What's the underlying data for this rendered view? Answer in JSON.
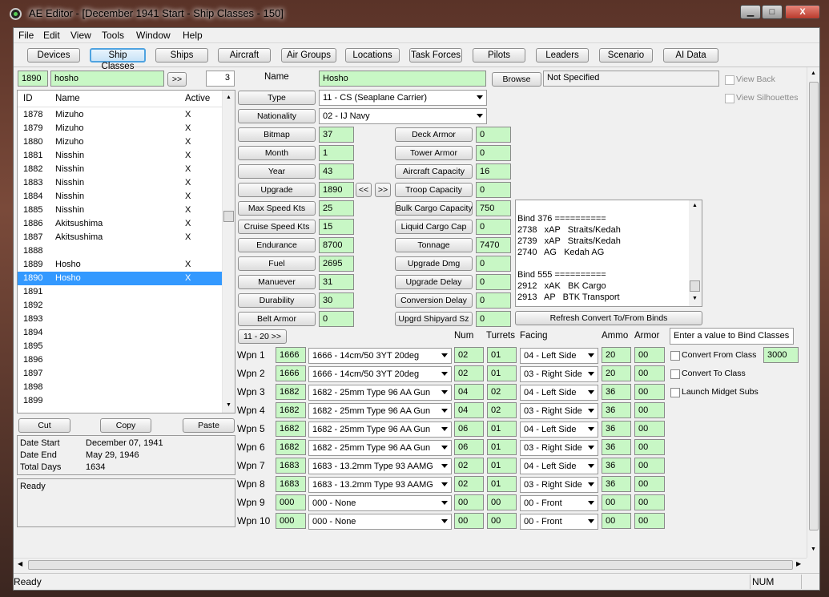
{
  "window": {
    "title": "AE Editor - [December 1941 Start - Ship Classes - 150]",
    "min": "▁",
    "max": "□",
    "close": "X"
  },
  "menu": [
    "File",
    "Edit",
    "View",
    "Tools",
    "Window",
    "Help"
  ],
  "tabs": [
    "Devices",
    "Ship Classes",
    "Ships",
    "Aircraft",
    "Air Groups",
    "Locations",
    "Task Forces",
    "Pilots",
    "Leaders",
    "Scenario",
    "AI Data"
  ],
  "search": {
    "id": "1890",
    "name": "hosho",
    "go": ">>",
    "count": "3"
  },
  "list": {
    "headers": [
      "ID",
      "Name",
      "Active"
    ],
    "rows": [
      [
        "1878",
        "Mizuho",
        "X"
      ],
      [
        "1879",
        "Mizuho",
        "X"
      ],
      [
        "1880",
        "Mizuho",
        "X"
      ],
      [
        "1881",
        "Nisshin",
        "X"
      ],
      [
        "1882",
        "Nisshin",
        "X"
      ],
      [
        "1883",
        "Nisshin",
        "X"
      ],
      [
        "1884",
        "Nisshin",
        "X"
      ],
      [
        "1885",
        "Nisshin",
        "X"
      ],
      [
        "1886",
        "Akitsushima",
        "X"
      ],
      [
        "1887",
        "Akitsushima",
        "X"
      ],
      [
        "1888",
        "",
        ""
      ],
      [
        "1889",
        "Hosho",
        "X"
      ],
      [
        "1890",
        "Hosho",
        "X"
      ],
      [
        "1891",
        "",
        ""
      ],
      [
        "1892",
        "",
        ""
      ],
      [
        "1893",
        "",
        ""
      ],
      [
        "1894",
        "",
        ""
      ],
      [
        "1895",
        "",
        ""
      ],
      [
        "1896",
        "",
        ""
      ],
      [
        "1897",
        "",
        ""
      ],
      [
        "1898",
        "",
        ""
      ],
      [
        "1899",
        "",
        ""
      ]
    ]
  },
  "actions": {
    "cut": "Cut",
    "copy": "Copy",
    "paste": "Paste"
  },
  "dates": {
    "start_label": "Date Start",
    "start": "December 07, 1941",
    "end_label": "Date End",
    "end": "May 29, 1946",
    "days_label": "Total Days",
    "days": "1634"
  },
  "log": "Ready",
  "name": {
    "label": "Name",
    "value": "Hosho",
    "browse": "Browse",
    "file": "Not Specified"
  },
  "view": {
    "back": "View Back",
    "silhouettes": "View Silhouettes"
  },
  "type": {
    "label": "Type",
    "value": "11 - CS (Seaplane Carrier)"
  },
  "nationality": {
    "label": "Nationality",
    "value": "02 - IJ Navy"
  },
  "left_fields": [
    [
      "Bitmap",
      "37"
    ],
    [
      "Month",
      "1"
    ],
    [
      "Year",
      "43"
    ],
    [
      "Upgrade",
      "1890"
    ],
    [
      "Max Speed Kts",
      "25"
    ],
    [
      "Cruise Speed Kts",
      "15"
    ],
    [
      "Endurance",
      "8700"
    ],
    [
      "Fuel",
      "2695"
    ],
    [
      "Manuever",
      "31"
    ],
    [
      "Durability",
      "30"
    ],
    [
      "Belt Armor",
      "0"
    ]
  ],
  "upgrade_nav": {
    "prev": "<<",
    "next": ">>"
  },
  "right_fields": [
    [
      "Deck Armor",
      "0"
    ],
    [
      "Tower Armor",
      "0"
    ],
    [
      "Aircraft Capacity",
      "16"
    ],
    [
      "Troop Capacity",
      "0"
    ],
    [
      "Bulk Cargo Capacity",
      "750"
    ],
    [
      "Liquid Cargo Cap",
      "0"
    ],
    [
      "Tonnage",
      "7470"
    ],
    [
      "Upgrade Dmg",
      "0"
    ],
    [
      "Upgrade Delay",
      "0"
    ],
    [
      "Conversion Delay",
      "0"
    ],
    [
      "Upgrd Shipyard Sz",
      "0"
    ]
  ],
  "binds": [
    "",
    "Bind 376 ==========",
    "2738   xAP   Straits/Kedah",
    "2739   xAP   Straits/Kedah",
    "2740   AG   Kedah AG",
    "",
    "Bind 555 ==========",
    "2912   xAK   BK Cargo",
    "2913   AP   BTK Transport"
  ],
  "refresh": "Refresh Convert To/From Binds",
  "weapons_nav": "11 - 20  >>",
  "weapon_headers": {
    "num": "Num",
    "turrets": "Turrets",
    "facing": "Facing",
    "ammo": "Ammo",
    "armor": "Armor"
  },
  "weapons": [
    [
      "Wpn 1",
      "1666",
      "1666 - 14cm/50 3YT 20deg",
      "02",
      "01",
      "04 - Left Side",
      "20",
      "00"
    ],
    [
      "Wpn 2",
      "1666",
      "1666 - 14cm/50 3YT 20deg",
      "02",
      "01",
      "03 - Right Side",
      "20",
      "00"
    ],
    [
      "Wpn 3",
      "1682",
      "1682 - 25mm Type 96 AA Gun",
      "04",
      "02",
      "04 - Left Side",
      "36",
      "00"
    ],
    [
      "Wpn 4",
      "1682",
      "1682 - 25mm Type 96 AA Gun",
      "04",
      "02",
      "03 - Right Side",
      "36",
      "00"
    ],
    [
      "Wpn 5",
      "1682",
      "1682 - 25mm Type 96 AA Gun",
      "06",
      "01",
      "04 - Left Side",
      "36",
      "00"
    ],
    [
      "Wpn 6",
      "1682",
      "1682 - 25mm Type 96 AA Gun",
      "06",
      "01",
      "03 - Right Side",
      "36",
      "00"
    ],
    [
      "Wpn 7",
      "1683",
      "1683 - 13.2mm Type 93 AAMG",
      "02",
      "01",
      "04 - Left Side",
      "36",
      "00"
    ],
    [
      "Wpn 8",
      "1683",
      "1683 - 13.2mm Type 93 AAMG",
      "02",
      "01",
      "03 - Right Side",
      "36",
      "00"
    ],
    [
      "Wpn 9",
      "000",
      "000 - None",
      "00",
      "00",
      "00 - Front",
      "00",
      "00"
    ],
    [
      "Wpn 10",
      "000",
      "000 - None",
      "00",
      "00",
      "00 - Front",
      "00",
      "00"
    ]
  ],
  "bind_box": {
    "label": "Enter a value to Bind Classes",
    "convert_from": "Convert From Class",
    "convert_from_value": "3000",
    "convert_to": "Convert To Class",
    "midget": "Launch Midget Subs"
  },
  "status": {
    "text": "Ready",
    "num": "NUM"
  }
}
